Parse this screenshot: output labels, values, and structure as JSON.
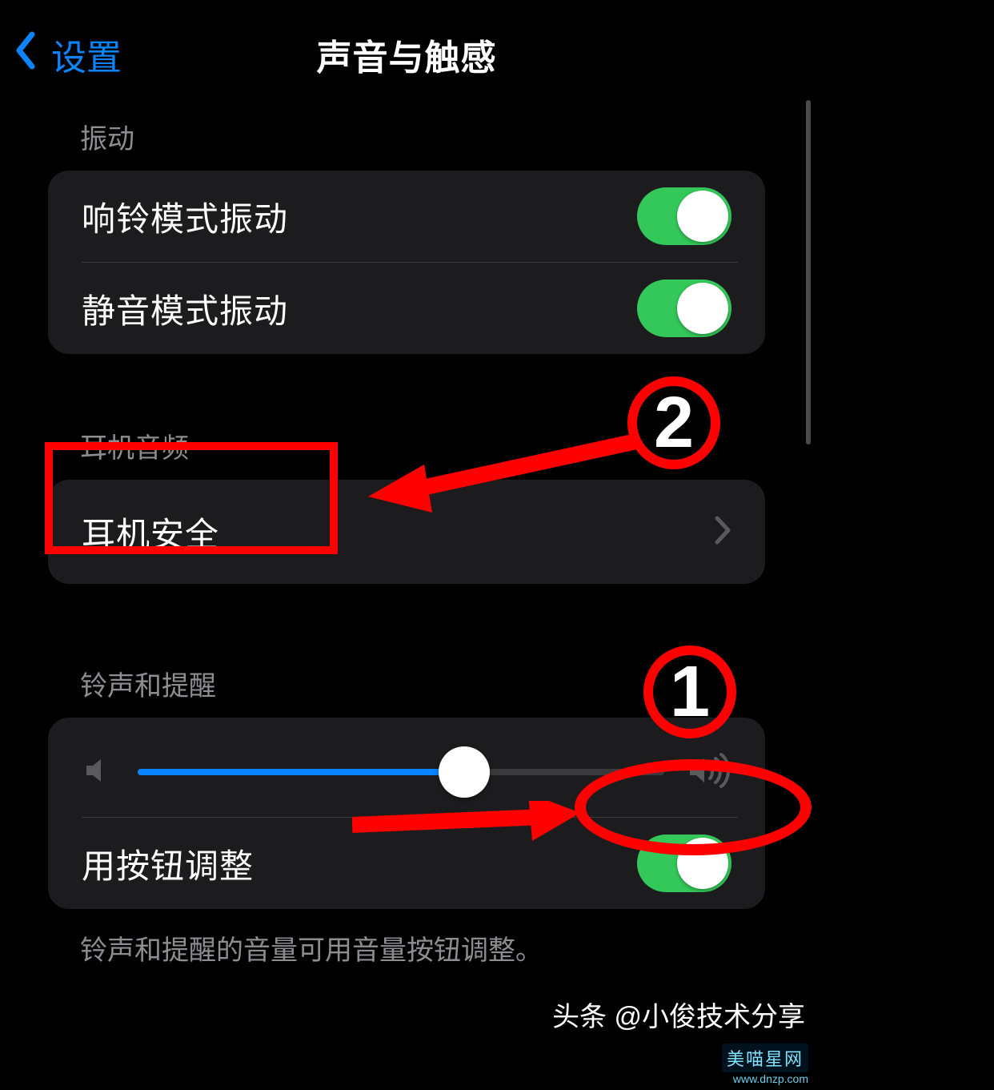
{
  "header": {
    "back_label": "设置",
    "title": "声音与触感"
  },
  "sections": {
    "vibration": {
      "header": "振动",
      "ring_vibrate": "响铃模式振动",
      "silent_vibrate": "静音模式振动"
    },
    "headphone": {
      "header": "耳机音频",
      "safety": "耳机安全"
    },
    "ringer": {
      "header": "铃声和提醒",
      "slider_percent": 62,
      "change_with_buttons": "用按钮调整",
      "footer": "铃声和提醒的音量可用音量按钮调整。"
    }
  },
  "toggles": {
    "ring_vibrate_on": true,
    "silent_vibrate_on": true,
    "change_with_buttons_on": true
  },
  "annotations": {
    "label_1": "1",
    "label_2": "2"
  },
  "watermarks": {
    "toutiao": "头条 @小俊技术分享",
    "site1": "美喵星网",
    "site2": "www.dnzp.com"
  },
  "colors": {
    "accent_blue": "#0a84ff",
    "toggle_green": "#34c759",
    "annotation_red": "#ff0000"
  },
  "icons": {
    "back": "chevron-left-icon",
    "disclosure": "chevron-right-icon",
    "vol_low": "volume-low-icon",
    "vol_high": "volume-high-icon"
  }
}
